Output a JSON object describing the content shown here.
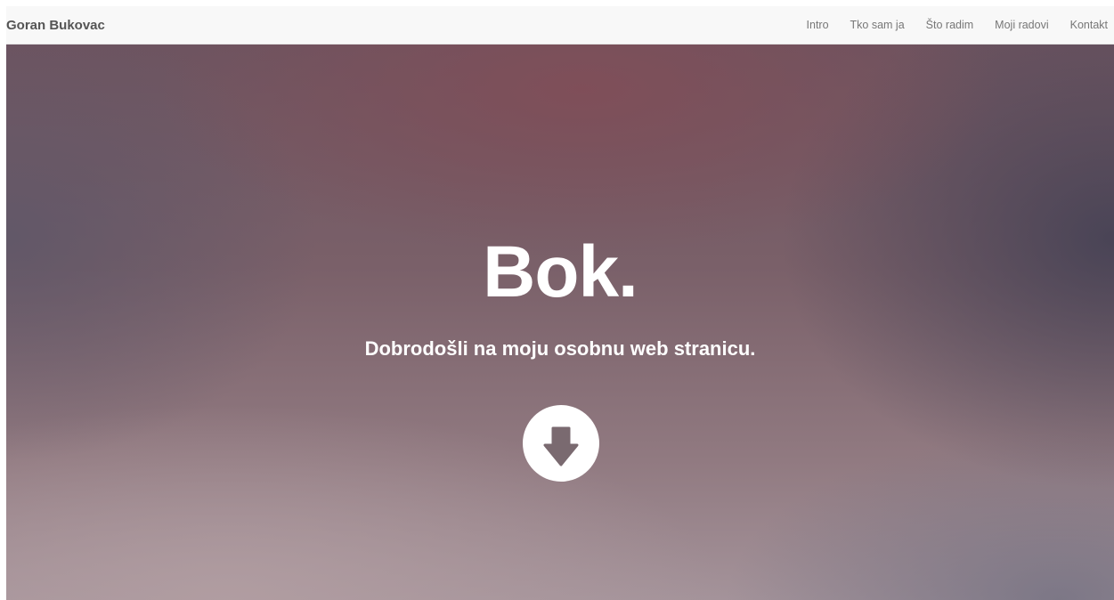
{
  "navbar": {
    "brand": "Goran Bukovac",
    "links": [
      "Intro",
      "Tko sam ja",
      "Što radim",
      "Moji radovi",
      "Kontakt"
    ]
  },
  "hero": {
    "title": "Bok.",
    "subtitle": "Dobrodošli na moju osobnu web stranicu.",
    "scroll_icon": "arrow-down-icon"
  },
  "colors": {
    "navbar_bg": "#f8f8f8",
    "brand_text": "#555555",
    "nav_link_text": "#777777",
    "hero_text": "#ffffff"
  }
}
